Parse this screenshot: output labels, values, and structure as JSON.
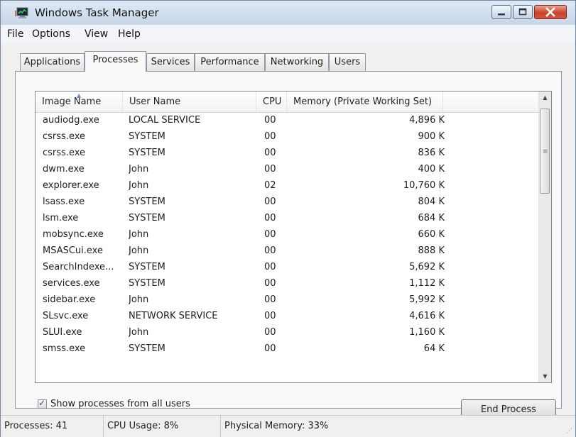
{
  "window": {
    "title": "Windows Task Manager"
  },
  "menu": [
    "File",
    "Options",
    "View",
    "Help"
  ],
  "tabs": [
    {
      "label": "Applications",
      "active": false
    },
    {
      "label": "Processes",
      "active": true
    },
    {
      "label": "Services",
      "active": false
    },
    {
      "label": "Performance",
      "active": false
    },
    {
      "label": "Networking",
      "active": false
    },
    {
      "label": "Users",
      "active": false
    }
  ],
  "table": {
    "columns": [
      "Image Name",
      "User Name",
      "CPU",
      "Memory (Private Working Set)"
    ],
    "sort_column": "Image Name",
    "rows": [
      {
        "name": "audiodg.exe",
        "user": "LOCAL SERVICE",
        "cpu": "00",
        "memory": "4,896 K"
      },
      {
        "name": "csrss.exe",
        "user": "SYSTEM",
        "cpu": "00",
        "memory": "900 K"
      },
      {
        "name": "csrss.exe",
        "user": "SYSTEM",
        "cpu": "00",
        "memory": "836 K"
      },
      {
        "name": "dwm.exe",
        "user": "John",
        "cpu": "00",
        "memory": "400 K"
      },
      {
        "name": "explorer.exe",
        "user": "John",
        "cpu": "02",
        "memory": "10,760 K"
      },
      {
        "name": "lsass.exe",
        "user": "SYSTEM",
        "cpu": "00",
        "memory": "804 K"
      },
      {
        "name": "lsm.exe",
        "user": "SYSTEM",
        "cpu": "00",
        "memory": "684 K"
      },
      {
        "name": "mobsync.exe",
        "user": "John",
        "cpu": "00",
        "memory": "660 K"
      },
      {
        "name": "MSASCui.exe",
        "user": "John",
        "cpu": "00",
        "memory": "888 K"
      },
      {
        "name": "SearchIndexe...",
        "user": "SYSTEM",
        "cpu": "00",
        "memory": "5,692 K"
      },
      {
        "name": "services.exe",
        "user": "SYSTEM",
        "cpu": "00",
        "memory": "1,112 K"
      },
      {
        "name": "sidebar.exe",
        "user": "John",
        "cpu": "00",
        "memory": "5,992 K"
      },
      {
        "name": "SLsvc.exe",
        "user": "NETWORK SERVICE",
        "cpu": "00",
        "memory": "4,616 K"
      },
      {
        "name": "SLUI.exe",
        "user": "John",
        "cpu": "00",
        "memory": "1,160 K"
      },
      {
        "name": "smss.exe",
        "user": "SYSTEM",
        "cpu": "00",
        "memory": "64 K"
      }
    ]
  },
  "show_all_users": {
    "label": "Show processes from all users",
    "checked": true
  },
  "end_process_label": "End Process",
  "status": {
    "processes": "Processes: 41",
    "cpu_usage": "CPU Usage: 8%",
    "physical_memory": "Physical Memory: 33%"
  },
  "colors": {
    "close_button": "#c9432b",
    "titlebar": "#c7d6e8",
    "sort_arrow": "#6a8ab8"
  },
  "icons": [
    "task-manager-app-icon",
    "minimize-icon",
    "maximize-icon",
    "close-icon",
    "sort-ascending-icon",
    "scroll-up-arrow-icon",
    "scroll-down-arrow-icon",
    "checkmark-icon",
    "resize-grip-icon"
  ]
}
